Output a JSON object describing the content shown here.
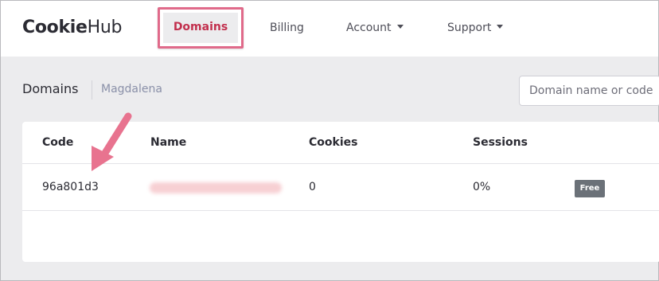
{
  "brand": {
    "part1": "Cookie",
    "part2": "Hub"
  },
  "nav": {
    "domains": "Domains",
    "billing": "Billing",
    "account": "Account",
    "support": "Support"
  },
  "header": {
    "title": "Domains",
    "subtitle": "Magdalena",
    "search_placeholder": "Domain name or code"
  },
  "table": {
    "columns": [
      "Code",
      "Name",
      "Cookies",
      "Sessions"
    ],
    "rows": [
      {
        "code": "96a801d3",
        "name": "",
        "cookies": "0",
        "sessions": "0%",
        "plan": "Free"
      }
    ]
  },
  "colors": {
    "highlight": "#e06a8a",
    "active_nav": "#c2304e",
    "badge": "#6b7178"
  }
}
